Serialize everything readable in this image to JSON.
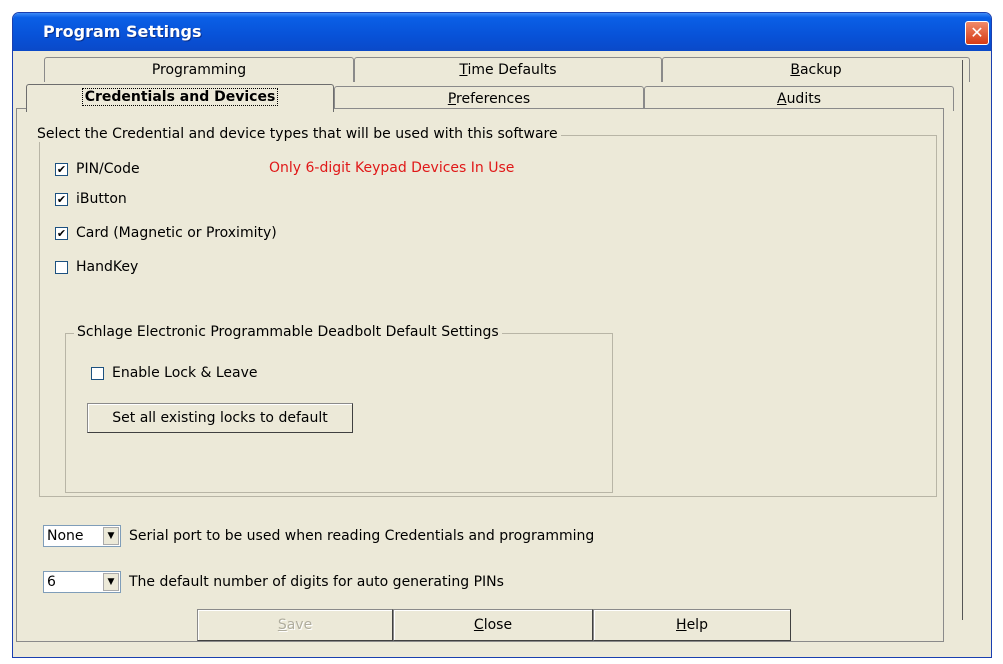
{
  "window": {
    "title": "Program Settings",
    "close_glyph": "✕"
  },
  "tabs_back": [
    {
      "label": "Programming",
      "u": ""
    },
    {
      "label": "ime Defaults",
      "u": "T"
    },
    {
      "label": "ackup",
      "u": "B"
    }
  ],
  "tabs_front": [
    {
      "label": "Credentials and Devices",
      "u": ""
    },
    {
      "label": "references",
      "u": "P"
    },
    {
      "label": "udits",
      "u": "A"
    }
  ],
  "credentials": {
    "legend": "Select the Credential and device types that will be used with this software",
    "items": [
      {
        "label": "PIN/Code",
        "checked": true
      },
      {
        "label": "iButton",
        "checked": true
      },
      {
        "label": "Card (Magnetic or Proximity)",
        "checked": true
      },
      {
        "label": "HandKey",
        "checked": false
      }
    ],
    "warning": "Only 6-digit Keypad Devices In Use",
    "warning_color": "#e01818"
  },
  "deadbolt": {
    "legend": "Schlage Electronic Programmable Deadbolt Default Settings",
    "enable_label": "Enable Lock & Leave",
    "enable_checked": false,
    "reset_button": "Set all existing locks to default"
  },
  "serial_port": {
    "value": "None",
    "description": "Serial port to be used when reading Credentials and programming"
  },
  "pin_digits": {
    "value": "6",
    "description": "The default number of digits for auto generating PINs"
  },
  "buttons": {
    "save_u": "S",
    "save_rest": "ave",
    "close_u": "C",
    "close_rest": "lose",
    "help_u": "H",
    "help_rest": "elp"
  },
  "checkmark": "✔",
  "dropdown_glyph": "▼"
}
